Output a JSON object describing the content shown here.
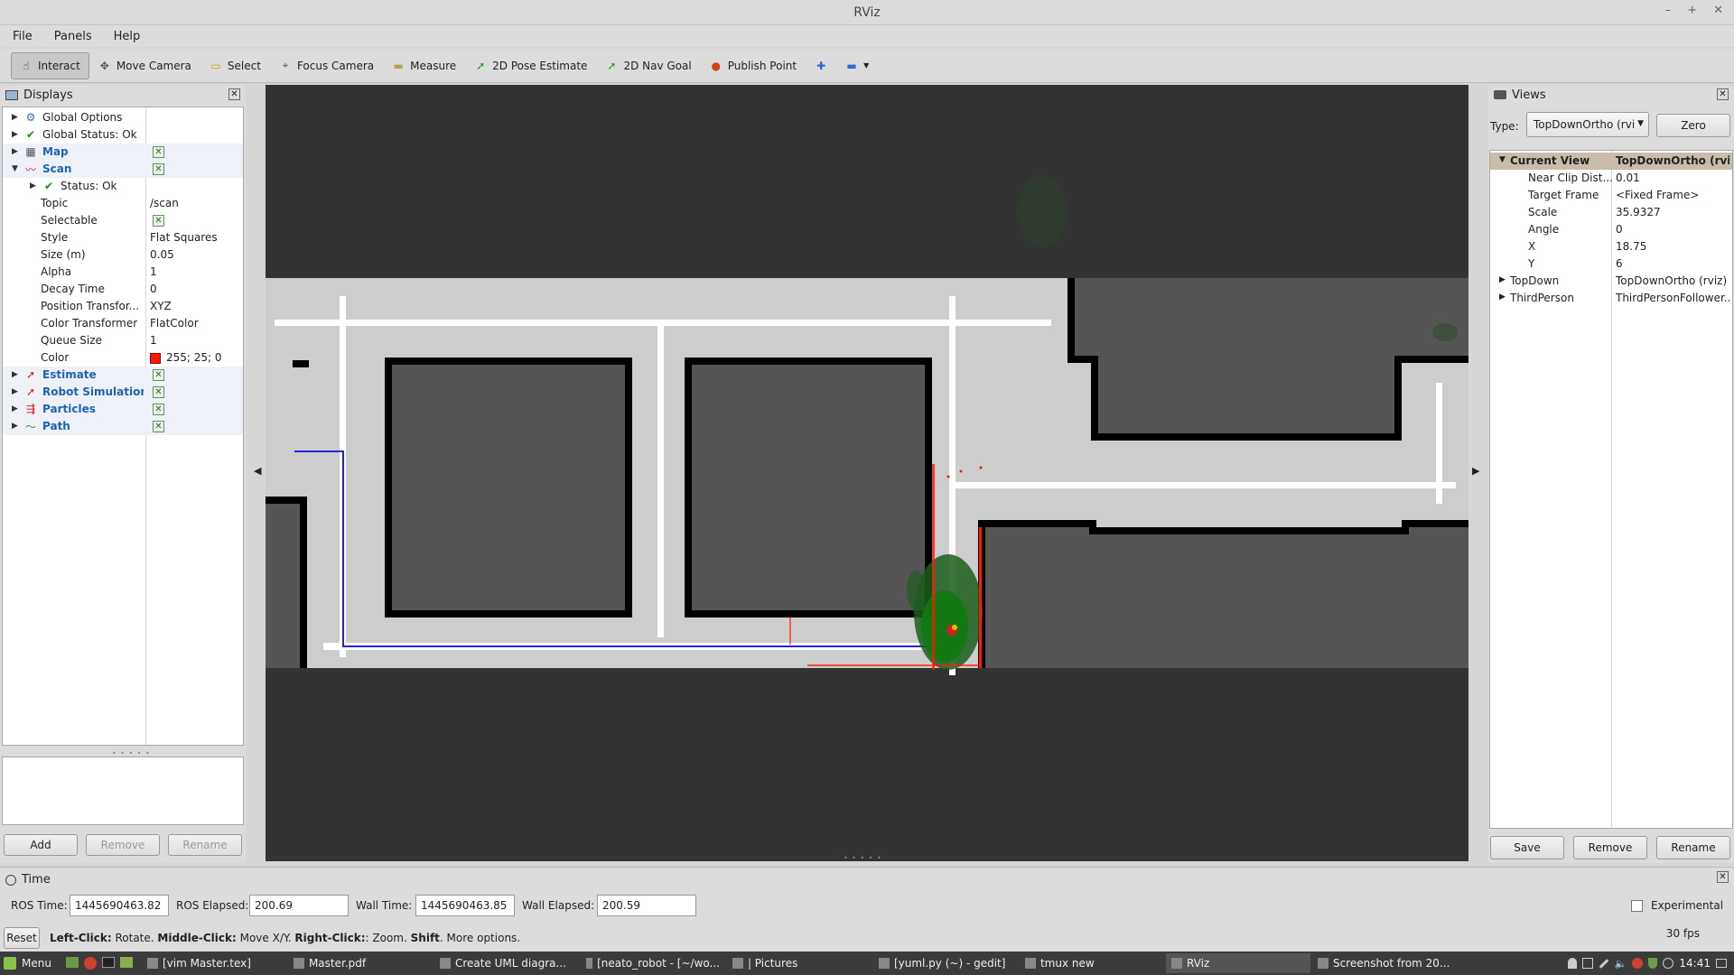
{
  "window": {
    "title": "RViz",
    "controls": [
      "–",
      "+",
      "✕"
    ]
  },
  "menu": [
    "File",
    "Panels",
    "Help"
  ],
  "toolbar": [
    {
      "label": "Interact",
      "icon": "hand-icon",
      "glyph": "☝",
      "active": true,
      "color": "#333333"
    },
    {
      "label": "Move Camera",
      "icon": "move-camera-icon",
      "glyph": "✥",
      "active": false,
      "color": "#555555"
    },
    {
      "label": "Select",
      "icon": "select-icon",
      "glyph": "▭",
      "active": false,
      "color": "#c9a400"
    },
    {
      "label": "Focus Camera",
      "icon": "focus-camera-icon",
      "glyph": "⌖",
      "active": false,
      "color": "#555555"
    },
    {
      "label": "Measure",
      "icon": "ruler-icon",
      "glyph": "▬",
      "active": false,
      "color": "#b8a060"
    },
    {
      "label": "2D Pose Estimate",
      "icon": "pose-arrow-icon",
      "glyph": "➚",
      "active": false,
      "color": "#1c9a1c"
    },
    {
      "label": "2D Nav Goal",
      "icon": "nav-goal-arrow-icon",
      "glyph": "➚",
      "active": false,
      "color": "#1c9a1c"
    },
    {
      "label": "Publish Point",
      "icon": "map-pin-icon",
      "glyph": "●",
      "active": false,
      "color": "#d2401c"
    }
  ],
  "displays": {
    "title": "Displays",
    "rows": [
      {
        "name": "Global Options",
        "value": "",
        "icon": "gear-icon",
        "glyph": "⚙",
        "level": 0,
        "arrow": "▶",
        "blue": false,
        "checkbox": false,
        "color": "#2d6db5"
      },
      {
        "name": "Global Status: Ok",
        "value": "",
        "icon": "check-icon",
        "glyph": "✔",
        "level": 0,
        "arrow": "▶",
        "blue": false,
        "checkbox": false,
        "color": "#1a8a1a"
      },
      {
        "name": "Map",
        "value": "",
        "icon": "map-icon",
        "glyph": "▦",
        "level": 0,
        "arrow": "▶",
        "blue": true,
        "checkbox": true,
        "color": "#555555"
      },
      {
        "name": "Scan",
        "value": "",
        "icon": "laser-scan-icon",
        "glyph": "〰",
        "level": 0,
        "arrow": "▼",
        "blue": true,
        "checkbox": true,
        "color": "#d02020"
      },
      {
        "name": "Status: Ok",
        "value": "",
        "icon": "check-icon",
        "glyph": "✔",
        "level": 1,
        "arrow": "▶",
        "blue": false,
        "checkbox": false,
        "color": "#1a8a1a"
      },
      {
        "name": "Topic",
        "value": "/scan",
        "icon": "",
        "glyph": "",
        "level": 1,
        "arrow": "",
        "blue": false,
        "checkbox": false,
        "color": ""
      },
      {
        "name": "Selectable",
        "value": "",
        "icon": "",
        "glyph": "",
        "level": 1,
        "arrow": "",
        "blue": false,
        "checkbox": true,
        "color": ""
      },
      {
        "name": "Style",
        "value": "Flat Squares",
        "icon": "",
        "glyph": "",
        "level": 1,
        "arrow": "",
        "blue": false,
        "checkbox": false,
        "color": ""
      },
      {
        "name": "Size (m)",
        "value": "0.05",
        "icon": "",
        "glyph": "",
        "level": 1,
        "arrow": "",
        "blue": false,
        "checkbox": false,
        "color": ""
      },
      {
        "name": "Alpha",
        "value": "1",
        "icon": "",
        "glyph": "",
        "level": 1,
        "arrow": "",
        "blue": false,
        "checkbox": false,
        "color": ""
      },
      {
        "name": "Decay Time",
        "value": "0",
        "icon": "",
        "glyph": "",
        "level": 1,
        "arrow": "",
        "blue": false,
        "checkbox": false,
        "color": ""
      },
      {
        "name": "Position Transfor...",
        "value": "XYZ",
        "icon": "",
        "glyph": "",
        "level": 1,
        "arrow": "",
        "blue": false,
        "checkbox": false,
        "color": ""
      },
      {
        "name": "Color Transformer",
        "value": "FlatColor",
        "icon": "",
        "glyph": "",
        "level": 1,
        "arrow": "",
        "blue": false,
        "checkbox": false,
        "color": ""
      },
      {
        "name": "Queue Size",
        "value": "1",
        "icon": "",
        "glyph": "",
        "level": 1,
        "arrow": "",
        "blue": false,
        "checkbox": false,
        "color": ""
      },
      {
        "name": "Color",
        "value": "255; 25; 0",
        "icon": "",
        "glyph": "",
        "level": 1,
        "arrow": "",
        "blue": false,
        "checkbox": false,
        "color": "#ff1900",
        "swatch": true
      },
      {
        "name": "Estimate",
        "value": "",
        "icon": "pose-arrow-icon",
        "glyph": "➚",
        "level": 0,
        "arrow": "▶",
        "blue": true,
        "checkbox": true,
        "color": "#d02020"
      },
      {
        "name": "Robot Simulation",
        "value": "",
        "icon": "pose-arrow-icon",
        "glyph": "➚",
        "level": 0,
        "arrow": "▶",
        "blue": true,
        "checkbox": true,
        "color": "#d02020"
      },
      {
        "name": "Particles",
        "value": "",
        "icon": "pose-array-icon",
        "glyph": "⇶",
        "level": 0,
        "arrow": "▶",
        "blue": true,
        "checkbox": true,
        "color": "#d02020"
      },
      {
        "name": "Path",
        "value": "",
        "icon": "path-icon",
        "glyph": "〜",
        "level": 0,
        "arrow": "▶",
        "blue": true,
        "checkbox": true,
        "color": "#1a9a1a"
      }
    ],
    "buttons": {
      "add": "Add",
      "remove": "Remove",
      "rename": "Rename"
    }
  },
  "views": {
    "title": "Views",
    "type_label": "Type:",
    "type_value": "TopDownOrtho (rvi",
    "zero_label": "Zero",
    "rows": [
      {
        "name": "Current View",
        "value": "TopDownOrtho (rviz)",
        "head": true,
        "arrow": "▼",
        "indent": 1
      },
      {
        "name": "Near Clip Dist...",
        "value": "0.01",
        "head": false,
        "arrow": "",
        "indent": 2
      },
      {
        "name": "Target Frame",
        "value": "<Fixed Frame>",
        "head": false,
        "arrow": "",
        "indent": 2
      },
      {
        "name": "Scale",
        "value": "35.9327",
        "head": false,
        "arrow": "",
        "indent": 2
      },
      {
        "name": "Angle",
        "value": "0",
        "head": false,
        "arrow": "",
        "indent": 2
      },
      {
        "name": "X",
        "value": "18.75",
        "head": false,
        "arrow": "",
        "indent": 2
      },
      {
        "name": "Y",
        "value": "6",
        "head": false,
        "arrow": "",
        "indent": 2
      },
      {
        "name": "TopDown",
        "value": "TopDownOrtho (rviz)",
        "head": false,
        "arrow": "▶",
        "indent": 1
      },
      {
        "name": "ThirdPerson",
        "value": "ThirdPersonFollower...",
        "head": false,
        "arrow": "▶",
        "indent": 1
      }
    ],
    "buttons": {
      "save": "Save",
      "remove": "Remove",
      "rename": "Rename"
    }
  },
  "time": {
    "title": "Time",
    "ros_time_label": "ROS Time:",
    "ros_time": "1445690463.82",
    "ros_elapsed_label": "ROS Elapsed:",
    "ros_elapsed": "200.69",
    "wall_time_label": "Wall Time:",
    "wall_time": "1445690463.85",
    "wall_elapsed_label": "Wall Elapsed:",
    "wall_elapsed": "200.59",
    "experimental_label": "Experimental"
  },
  "status": {
    "reset_label": "Reset",
    "hint_bold_1": "Left-Click:",
    "hint_1": " Rotate. ",
    "hint_bold_2": "Middle-Click:",
    "hint_2": " Move X/Y. ",
    "hint_bold_3": "Right-Click:",
    "hint_3": ": Zoom. ",
    "hint_bold_4": "Shift",
    "hint_4": ". More options.",
    "fps": "30 fps"
  },
  "taskbar": {
    "menu_label": "Menu",
    "tasks": [
      {
        "label": "[vim Master.tex]",
        "icon": "terminal-icon",
        "active": false
      },
      {
        "label": "Master.pdf",
        "icon": "pdf-icon",
        "active": false
      },
      {
        "label": "Create UML diagra...",
        "icon": "chrome-icon",
        "active": false
      },
      {
        "label": "[neato_robot - [~/wo...",
        "icon": "sublime-icon",
        "active": false
      },
      {
        "label": "| Pictures",
        "icon": "folder-icon",
        "active": false
      },
      {
        "label": "[yuml.py (~) - gedit]",
        "icon": "gedit-icon",
        "active": false
      },
      {
        "label": "tmux new",
        "icon": "terminal-icon",
        "active": false
      },
      {
        "label": "RViz",
        "icon": "rviz-icon",
        "active": true
      },
      {
        "label": "Screenshot from 20...",
        "icon": "screenshot-icon",
        "active": false
      }
    ],
    "clock": "14:41"
  }
}
